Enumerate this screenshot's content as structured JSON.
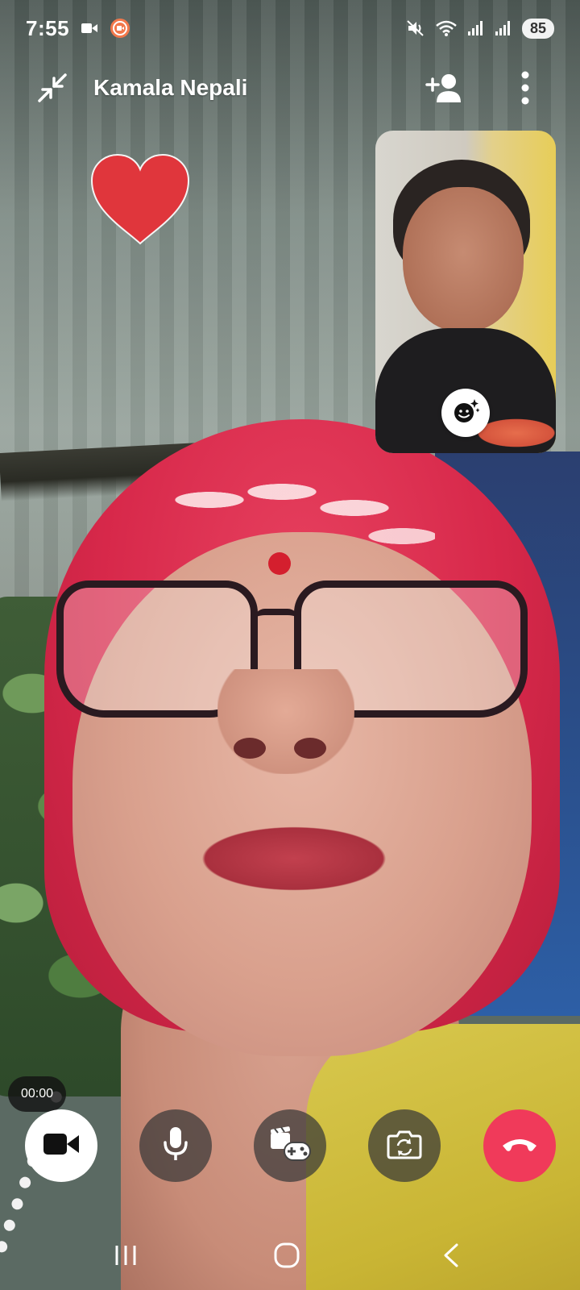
{
  "status_bar": {
    "time": "7:55",
    "battery": "85",
    "icons": [
      "video-camera-icon",
      "screen-recorder-icon",
      "mute-icon",
      "wifi-icon",
      "signal-bars-icon",
      "signal-bars-icon"
    ]
  },
  "call": {
    "contact_name": "Kamala Nepali",
    "timer": "00:00"
  },
  "header_buttons": [
    "collapse-icon",
    "add-person-icon",
    "more-vertical-icon"
  ],
  "reaction": {
    "icon": "heart-icon",
    "color": "#e0363c"
  },
  "self_view": {
    "effects_icon": "face-sparkle-icon"
  },
  "controls": [
    {
      "name": "video-toggle",
      "icon": "video-camera-icon",
      "active": true,
      "color": "#ffffff"
    },
    {
      "name": "microphone",
      "icon": "microphone-icon",
      "active": false
    },
    {
      "name": "games",
      "icon": "game-controller-icon",
      "active": false
    },
    {
      "name": "flip-camera",
      "icon": "camera-flip-icon",
      "active": false
    },
    {
      "name": "end-call",
      "icon": "phone-hangup-icon",
      "color": "#f03a5a"
    }
  ],
  "system_nav": [
    "recents-icon",
    "home-icon",
    "back-icon"
  ]
}
